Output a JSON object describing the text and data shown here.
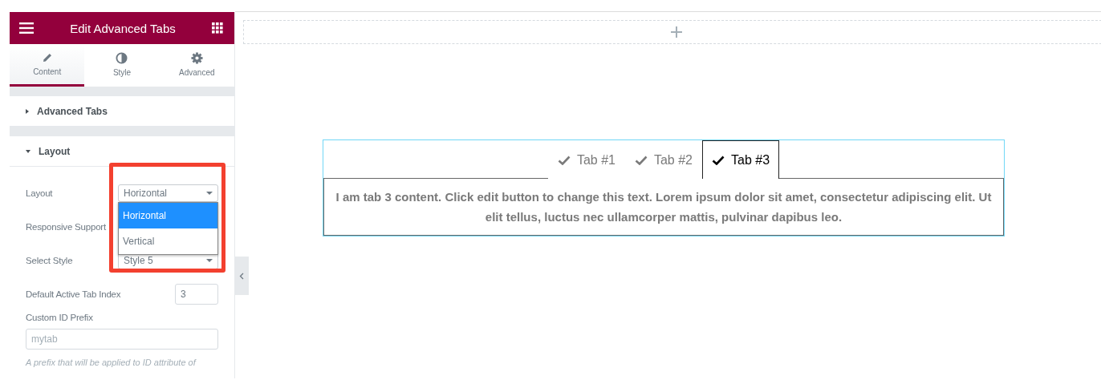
{
  "panel": {
    "title": "Edit Advanced Tabs",
    "tabs": [
      {
        "label": "Content",
        "selected": true
      },
      {
        "label": "Style",
        "selected": false
      },
      {
        "label": "Advanced",
        "selected": false
      }
    ],
    "sections": [
      {
        "title": "Advanced Tabs",
        "expanded": false
      },
      {
        "title": "Layout",
        "expanded": true
      }
    ],
    "controls": [
      {
        "kind": "select",
        "label": "Layout",
        "value": "Horizontal",
        "options": [
          {
            "label": "Horizontal",
            "selected": true
          },
          {
            "label": "Vertical",
            "selected": false
          }
        ],
        "open": true
      },
      {
        "kind": "label",
        "label": "Responsive Support"
      },
      {
        "kind": "select",
        "label": "Select Style",
        "value": "Style 5"
      },
      {
        "kind": "number",
        "label": "Default Active Tab Index",
        "value": "3"
      },
      {
        "kind": "text",
        "label": "Custom ID Prefix",
        "placeholder": "mytab"
      }
    ],
    "hint": "A prefix that will be applied to ID attribute of"
  },
  "canvas": {
    "tabs": [
      {
        "label": "Tab #1",
        "selected": false
      },
      {
        "label": "Tab #2",
        "selected": false
      },
      {
        "label": "Tab #3",
        "selected": true
      }
    ],
    "content": "I am tab 3 content. Click edit button to change this text. Lorem ipsum dolor sit amet, consectetur adipiscing elit. Ut elit tellus, luctus nec ullamcorper mattis, pulvinar dapibus leo."
  }
}
